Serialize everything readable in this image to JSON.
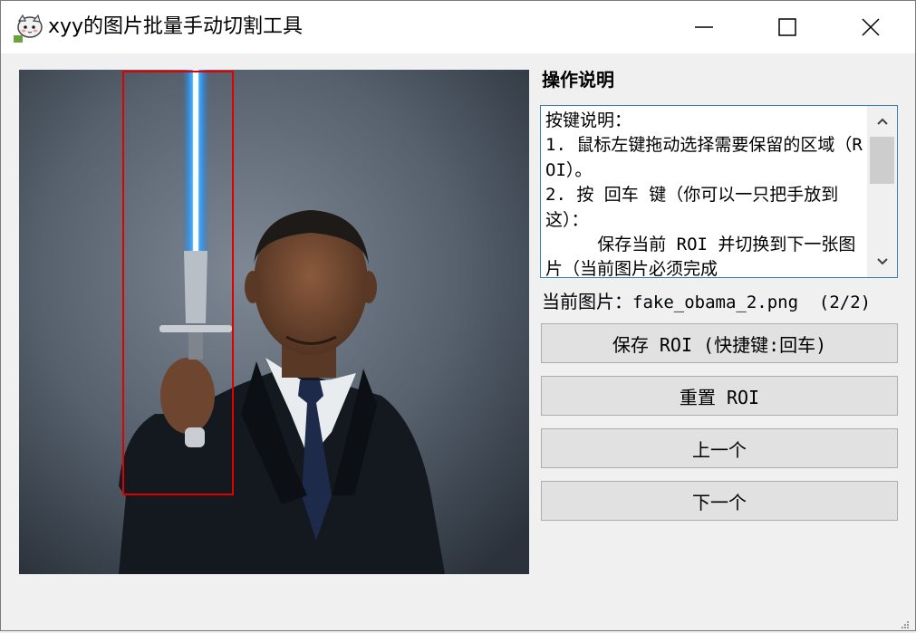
{
  "window": {
    "title": "xyy的图片批量手动切割工具"
  },
  "titlebar_buttons": {
    "minimize_icon": "minimize-icon",
    "maximize_icon": "maximize-icon",
    "close_icon": "close-icon"
  },
  "instructions": {
    "heading": "操作说明",
    "text": "按键说明：\n1. 鼠标左键拖动选择需要保留的区域（ROI）。\n2. 按 回车 键（你可以一只把手放到这）：\n     保存当前 ROI 并切换到下一张图片（当前图片必须完成"
  },
  "current_image": {
    "label": "当前图片：",
    "filename": "fake_obama_2.png",
    "counter": "(2/2)"
  },
  "buttons": {
    "save": "保存 ROI (快捷键:回车)",
    "reset": "重置 ROI",
    "previous": "上一个",
    "next": "下一个"
  },
  "colors": {
    "roi_border": "#e00000",
    "window_bg": "#f0f0f0",
    "button_bg": "#e1e1e1"
  }
}
